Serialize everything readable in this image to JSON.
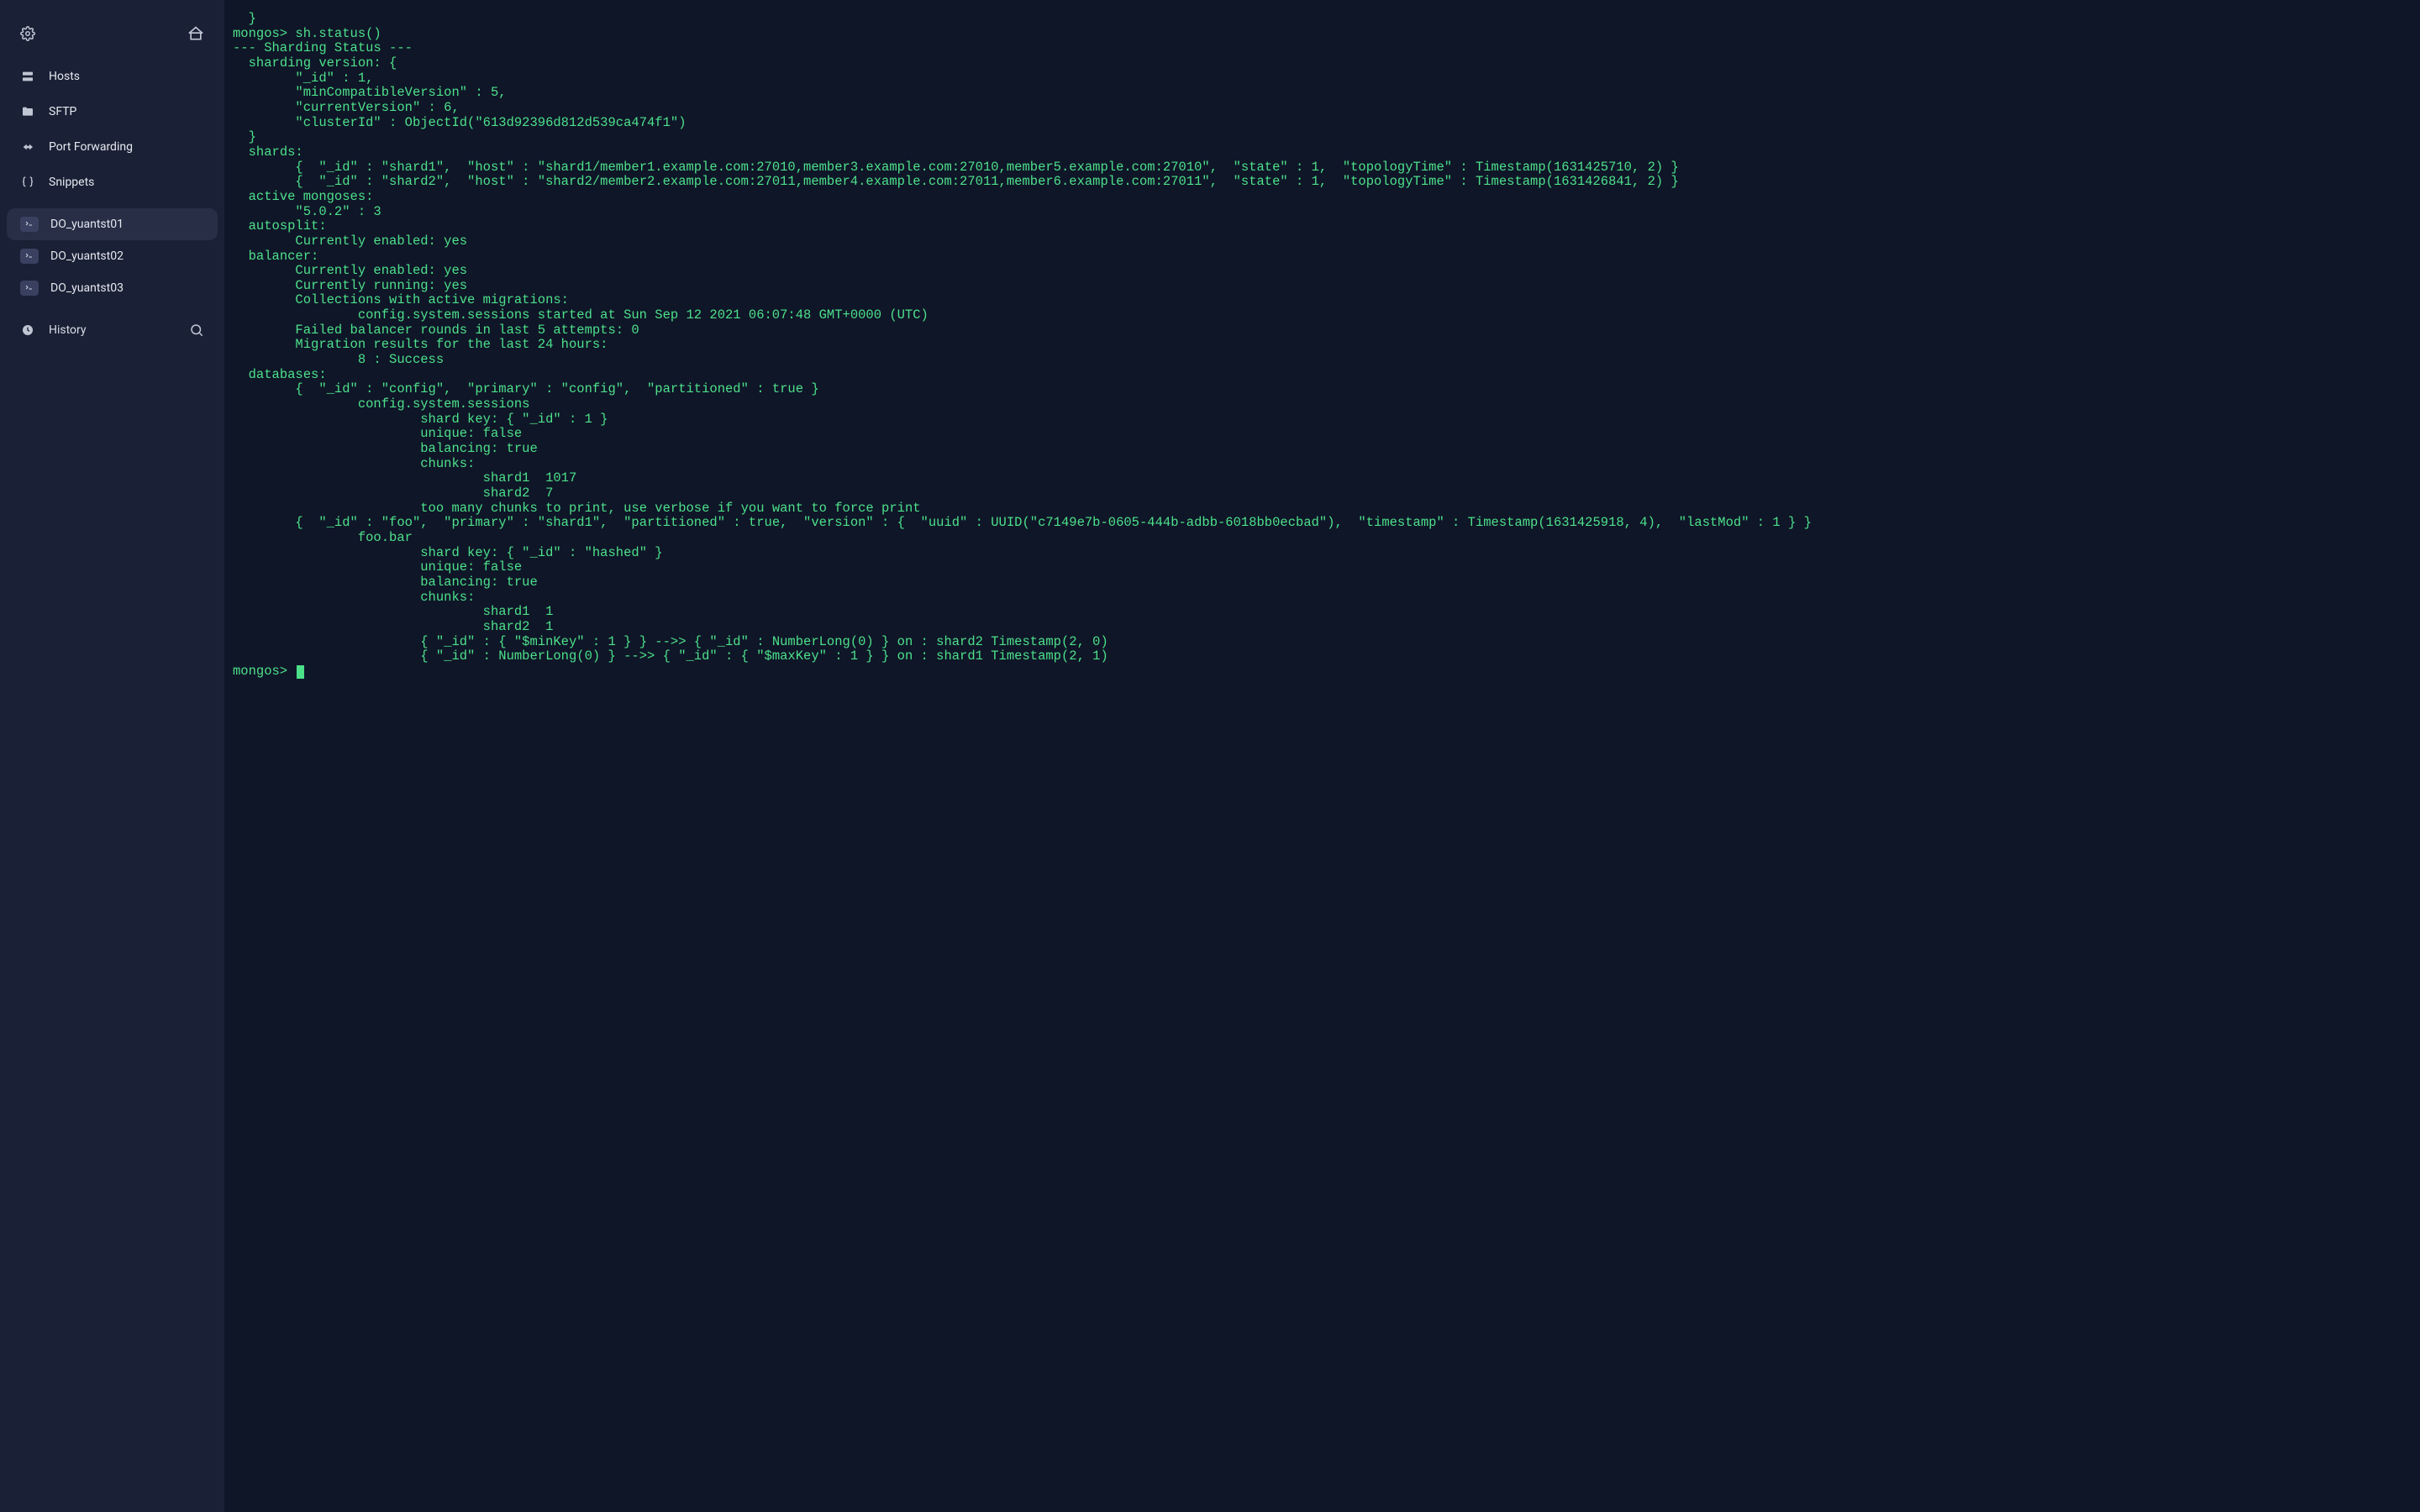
{
  "sidebar": {
    "nav": [
      {
        "label": "Hosts"
      },
      {
        "label": "SFTP"
      },
      {
        "label": "Port Forwarding"
      },
      {
        "label": "Snippets"
      }
    ],
    "sessions": [
      {
        "label": "DO_yuantst01",
        "active": true
      },
      {
        "label": "DO_yuantst02",
        "active": false
      },
      {
        "label": "DO_yuantst03",
        "active": false
      }
    ],
    "history_label": "History"
  },
  "terminal": {
    "output": "  }\nmongos> sh.status()\n--- Sharding Status ---\n  sharding version: {\n        \"_id\" : 1,\n        \"minCompatibleVersion\" : 5,\n        \"currentVersion\" : 6,\n        \"clusterId\" : ObjectId(\"613d92396d812d539ca474f1\")\n  }\n  shards:\n        {  \"_id\" : \"shard1\",  \"host\" : \"shard1/member1.example.com:27010,member3.example.com:27010,member5.example.com:27010\",  \"state\" : 1,  \"topologyTime\" : Timestamp(1631425710, 2) }\n        {  \"_id\" : \"shard2\",  \"host\" : \"shard2/member2.example.com:27011,member4.example.com:27011,member6.example.com:27011\",  \"state\" : 1,  \"topologyTime\" : Timestamp(1631426841, 2) }\n  active mongoses:\n        \"5.0.2\" : 3\n  autosplit:\n        Currently enabled: yes\n  balancer:\n        Currently enabled: yes\n        Currently running: yes\n        Collections with active migrations:\n                config.system.sessions started at Sun Sep 12 2021 06:07:48 GMT+0000 (UTC)\n        Failed balancer rounds in last 5 attempts: 0\n        Migration results for the last 24 hours:\n                8 : Success\n  databases:\n        {  \"_id\" : \"config\",  \"primary\" : \"config\",  \"partitioned\" : true }\n                config.system.sessions\n                        shard key: { \"_id\" : 1 }\n                        unique: false\n                        balancing: true\n                        chunks:\n                                shard1  1017\n                                shard2  7\n                        too many chunks to print, use verbose if you want to force print\n        {  \"_id\" : \"foo\",  \"primary\" : \"shard1\",  \"partitioned\" : true,  \"version\" : {  \"uuid\" : UUID(\"c7149e7b-0605-444b-adbb-6018bb0ecbad\"),  \"timestamp\" : Timestamp(1631425918, 4),  \"lastMod\" : 1 } }\n                foo.bar\n                        shard key: { \"_id\" : \"hashed\" }\n                        unique: false\n                        balancing: true\n                        chunks:\n                                shard1  1\n                                shard2  1\n                        { \"_id\" : { \"$minKey\" : 1 } } -->> { \"_id\" : NumberLong(0) } on : shard2 Timestamp(2, 0)\n                        { \"_id\" : NumberLong(0) } -->> { \"_id\" : { \"$maxKey\" : 1 } } on : shard1 Timestamp(2, 1)\nmongos> "
  }
}
